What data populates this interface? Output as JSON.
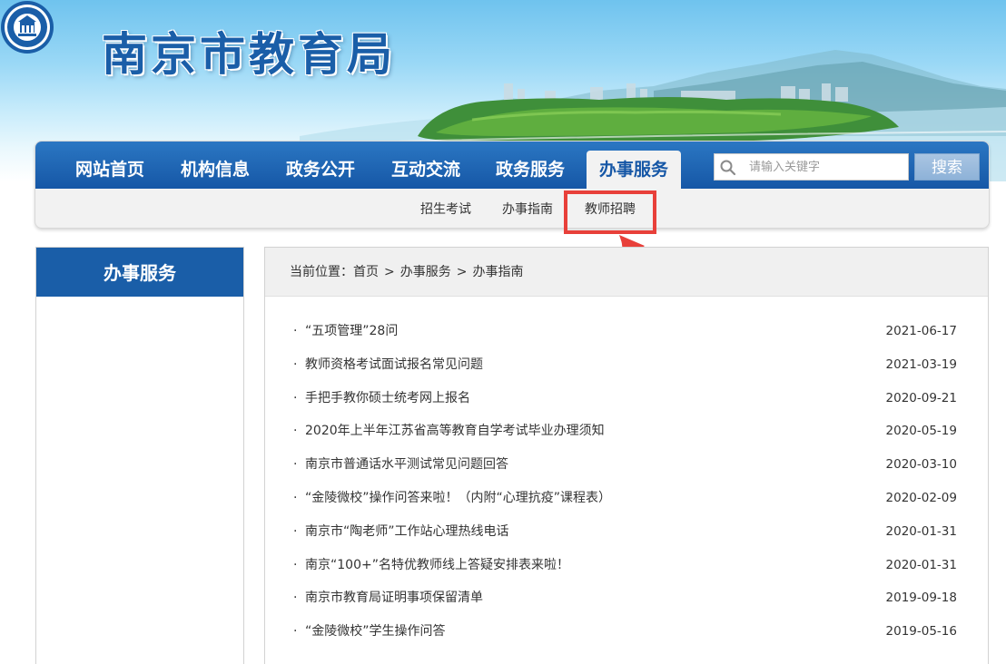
{
  "header": {
    "site_title": "南京市教育局",
    "logo_icon": "city-seal-icon"
  },
  "nav": {
    "items": [
      {
        "label": "网站首页",
        "active": false
      },
      {
        "label": "机构信息",
        "active": false
      },
      {
        "label": "政务公开",
        "active": false
      },
      {
        "label": "互动交流",
        "active": false
      },
      {
        "label": "政务服务",
        "active": false
      },
      {
        "label": "办事服务",
        "active": true
      }
    ],
    "search_placeholder": "请输入关键字",
    "search_button": "搜索",
    "search_icon": "search-icon",
    "accent_color": "#1a5ea8"
  },
  "sub_nav": {
    "items": [
      {
        "label": "招生考试"
      },
      {
        "label": "办事指南"
      },
      {
        "label": "教师招聘",
        "highlighted": true
      }
    ]
  },
  "annotation": {
    "highlight_color": "#e8403a",
    "arrow_icon": "red-arrow-icon"
  },
  "sidebar": {
    "title": "办事服务"
  },
  "breadcrumb": {
    "prefix": "当前位置：",
    "items": [
      "首页",
      "办事服务",
      "办事指南"
    ],
    "separator": ">"
  },
  "articles": [
    {
      "title": "“五项管理”28问",
      "date": "2021-06-17"
    },
    {
      "title": "教师资格考试面试报名常见问题",
      "date": "2021-03-19"
    },
    {
      "title": "手把手教你硕士统考网上报名",
      "date": "2020-09-21"
    },
    {
      "title": "2020年上半年江苏省高等教育自学考试毕业办理须知",
      "date": "2020-05-19"
    },
    {
      "title": "南京市普通话水平测试常见问题回答",
      "date": "2020-03-10"
    },
    {
      "title": "“金陵微校”操作问答来啦！（内附“心理抗疫”课程表）",
      "date": "2020-02-09"
    },
    {
      "title": "南京市“陶老师”工作站心理热线电话",
      "date": "2020-01-31"
    },
    {
      "title": "南京“100+”名特优教师线上答疑安排表来啦！",
      "date": "2020-01-31"
    },
    {
      "title": "南京市教育局证明事项保留清单",
      "date": "2019-09-18"
    },
    {
      "title": "“金陵微校”学生操作问答",
      "date": "2019-05-16"
    }
  ],
  "list_bullet": "·"
}
